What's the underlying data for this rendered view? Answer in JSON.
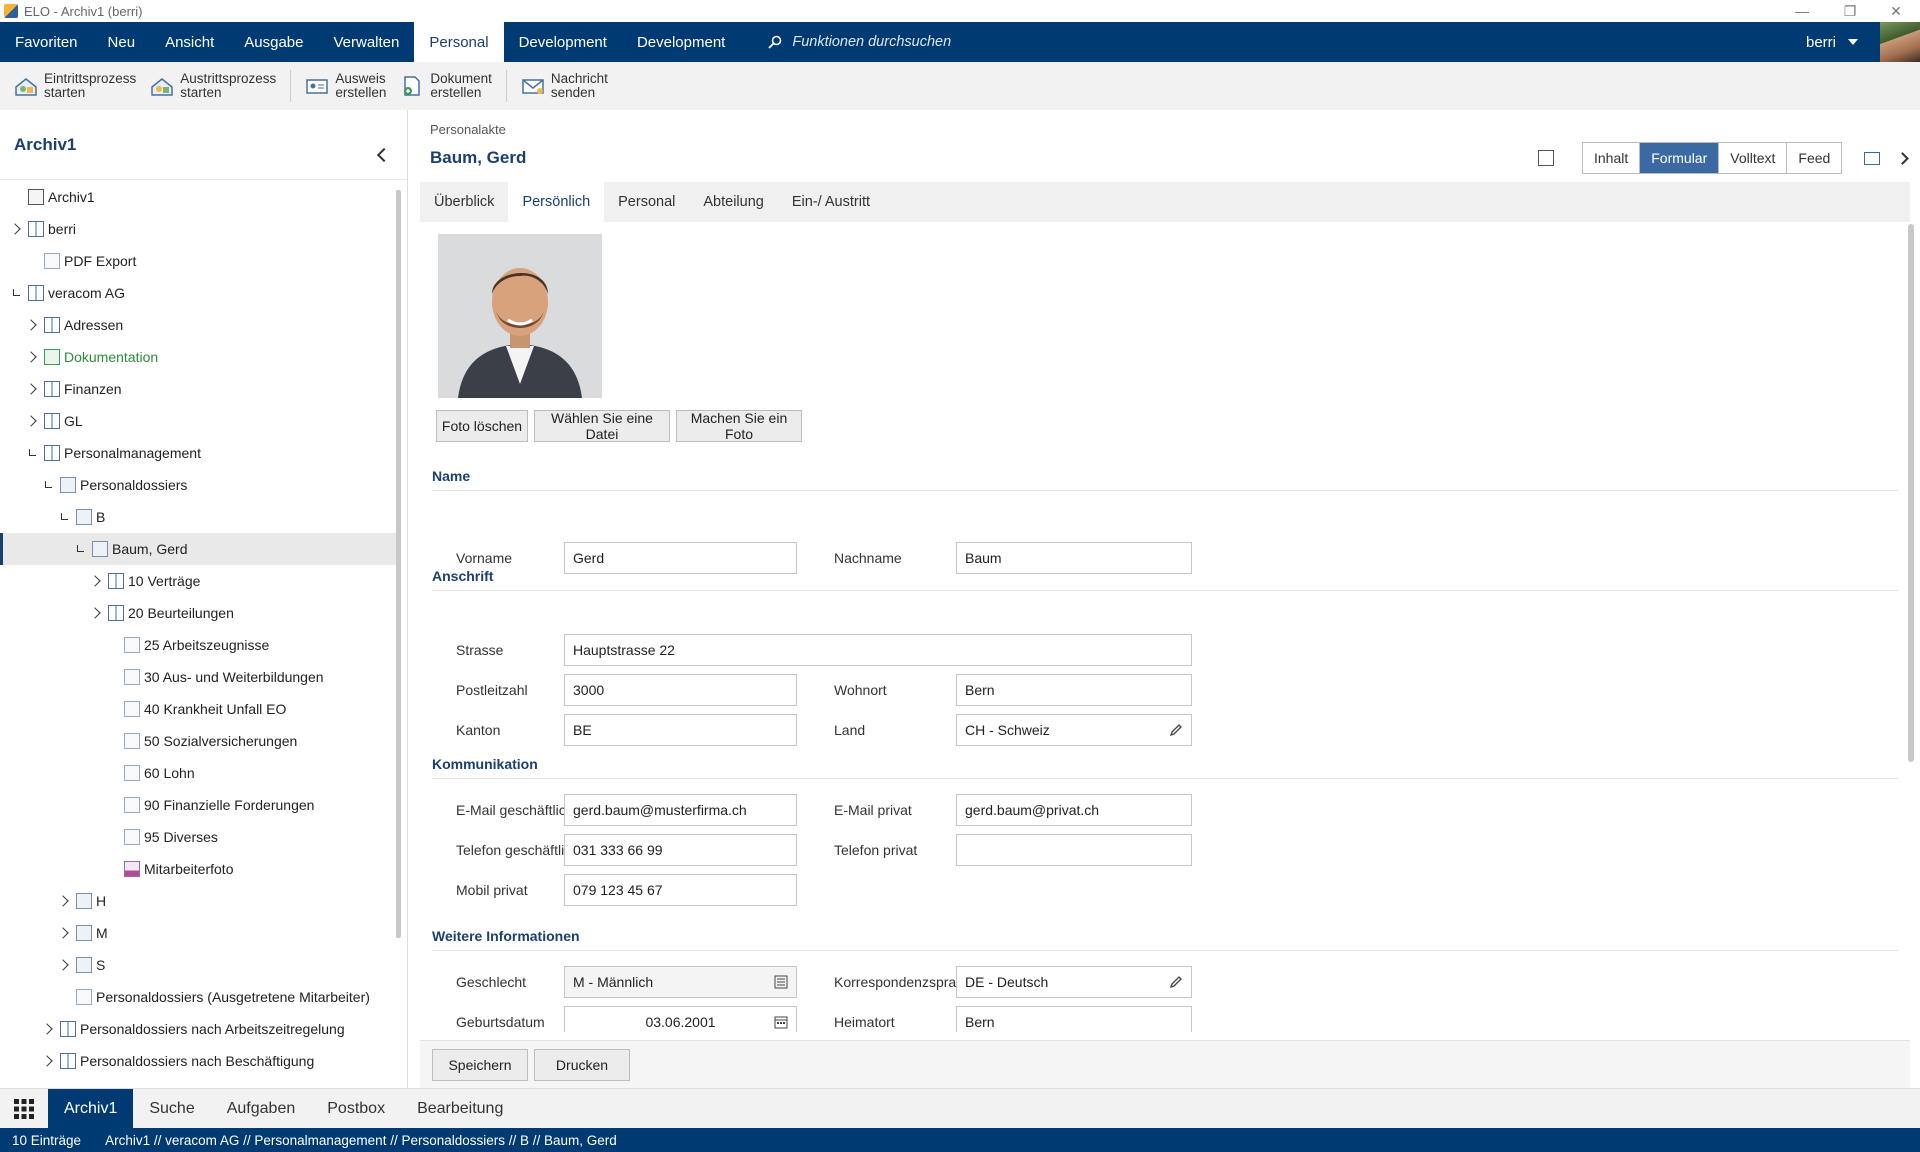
{
  "window": {
    "title": "ELO - Archiv1 (berri)"
  },
  "menubar": {
    "items": [
      "Favoriten",
      "Neu",
      "Ansicht",
      "Ausgabe",
      "Verwalten",
      "Personal",
      "Development",
      "Development"
    ],
    "active_index": 5,
    "search_placeholder": "Funktionen durchsuchen",
    "user": "berri"
  },
  "ribbon": {
    "buttons": [
      {
        "line1": "Eintrittsprozess",
        "line2": "starten",
        "icon": "process-start-icon"
      },
      {
        "line1": "Austrittsprozess",
        "line2": "starten",
        "icon": "process-exit-icon"
      },
      {
        "line1": "Ausweis",
        "line2": "erstellen",
        "icon": "id-card-icon"
      },
      {
        "line1": "Dokument",
        "line2": "erstellen",
        "icon": "document-add-icon"
      },
      {
        "line1": "Nachricht",
        "line2": "senden",
        "icon": "mail-icon"
      }
    ]
  },
  "leftpanel": {
    "title": "Archiv1",
    "tree": [
      {
        "label": "Archiv1",
        "level": 0,
        "exp": "none",
        "icon": "arch"
      },
      {
        "label": "berri",
        "level": 0,
        "exp": "closed",
        "icon": "cab"
      },
      {
        "label": "PDF Export",
        "level": 1,
        "exp": "none",
        "icon": "doc"
      },
      {
        "label": "veracom AG",
        "level": 0,
        "exp": "open",
        "icon": "cab"
      },
      {
        "label": "Adressen",
        "level": 1,
        "exp": "closed",
        "icon": "cab"
      },
      {
        "label": "Dokumentation",
        "level": 1,
        "exp": "closed",
        "icon": "fold-g",
        "green": true
      },
      {
        "label": "Finanzen",
        "level": 1,
        "exp": "closed",
        "icon": "cab"
      },
      {
        "label": "GL",
        "level": 1,
        "exp": "closed",
        "icon": "cab"
      },
      {
        "label": "Personalmanagement",
        "level": 1,
        "exp": "open",
        "icon": "cab"
      },
      {
        "label": "Personaldossiers",
        "level": 2,
        "exp": "open",
        "icon": "fold"
      },
      {
        "label": "B",
        "level": 3,
        "exp": "open",
        "icon": "fold"
      },
      {
        "label": "Baum, Gerd",
        "level": 4,
        "exp": "open",
        "icon": "fold",
        "selected": true
      },
      {
        "label": "10 Verträge",
        "level": 5,
        "exp": "closed",
        "icon": "cab"
      },
      {
        "label": "20 Beurteilungen",
        "level": 5,
        "exp": "closed",
        "icon": "cab"
      },
      {
        "label": "25 Arbeitszeugnisse",
        "level": 6,
        "exp": "none",
        "icon": "doc"
      },
      {
        "label": "30 Aus- und Weiterbildungen",
        "level": 6,
        "exp": "none",
        "icon": "doc"
      },
      {
        "label": "40 Krankheit Unfall EO",
        "level": 6,
        "exp": "none",
        "icon": "doc"
      },
      {
        "label": "50 Sozialversicherungen",
        "level": 6,
        "exp": "none",
        "icon": "doc"
      },
      {
        "label": "60 Lohn",
        "level": 6,
        "exp": "none",
        "icon": "doc"
      },
      {
        "label": "90 Finanzielle Forderungen",
        "level": 6,
        "exp": "none",
        "icon": "doc"
      },
      {
        "label": "95 Diverses",
        "level": 6,
        "exp": "none",
        "icon": "doc"
      },
      {
        "label": "Mitarbeiterfoto",
        "level": 6,
        "exp": "none",
        "icon": "img"
      },
      {
        "label": "H",
        "level": 3,
        "exp": "closed",
        "icon": "fold"
      },
      {
        "label": "M",
        "level": 3,
        "exp": "closed",
        "icon": "fold"
      },
      {
        "label": "S",
        "level": 3,
        "exp": "closed",
        "icon": "fold"
      },
      {
        "label": "Personaldossiers (Ausgetretene Mitarbeiter)",
        "level": 3,
        "exp": "none",
        "icon": "doc"
      },
      {
        "label": "Personaldossiers nach Arbeitszeitregelung",
        "level": 2,
        "exp": "closed",
        "icon": "cab"
      },
      {
        "label": "Personaldossiers nach Beschäftigung",
        "level": 2,
        "exp": "closed",
        "icon": "cab"
      }
    ]
  },
  "main": {
    "category": "Personalakte",
    "title": "Baum, Gerd",
    "view_tabs": [
      "Inhalt",
      "Formular",
      "Volltext",
      "Feed"
    ],
    "view_active": 1,
    "form_tabs": [
      "Überblick",
      "Persönlich",
      "Personal",
      "Abteilung",
      "Ein-/ Austritt"
    ],
    "form_active": 1
  },
  "form": {
    "photo_buttons": [
      "Foto löschen",
      "Wählen Sie eine Datei",
      "Machen Sie ein Foto"
    ],
    "sections": {
      "name": "Name",
      "address": "Anschrift",
      "communication": "Kommunikation",
      "more": "Weitere Informationen"
    },
    "fields": {
      "vorname": {
        "label": "Vorname",
        "value": "Gerd"
      },
      "nachname": {
        "label": "Nachname",
        "value": "Baum"
      },
      "strasse": {
        "label": "Strasse",
        "value": "Hauptstrasse 22"
      },
      "plz": {
        "label": "Postleitzahl",
        "value": "3000"
      },
      "wohnort": {
        "label": "Wohnort",
        "value": "Bern"
      },
      "kanton": {
        "label": "Kanton",
        "value": "BE"
      },
      "land": {
        "label": "Land",
        "value": "CH - Schweiz"
      },
      "email_g": {
        "label": "E-Mail geschäftlich",
        "value": "gerd.baum@musterfirma.ch"
      },
      "email_p": {
        "label": "E-Mail privat",
        "value": "gerd.baum@privat.ch"
      },
      "tel_g": {
        "label": "Telefon geschäftlich",
        "value": "031 333 66 99"
      },
      "tel_p": {
        "label": "Telefon privat",
        "value": ""
      },
      "mobil": {
        "label": "Mobil privat",
        "value": "079 123 45 67"
      },
      "geschlecht": {
        "label": "Geschlecht",
        "value": "M - Männlich"
      },
      "korr": {
        "label": "Korrespondenzsprache",
        "value": "DE - Deutsch"
      },
      "geburt": {
        "label": "Geburtsdatum",
        "value": "03.06.2001"
      },
      "heimat": {
        "label": "Heimatort",
        "value": "Bern"
      }
    },
    "footer_buttons": [
      "Speichern",
      "Drucken"
    ]
  },
  "bottomnav": {
    "tabs": [
      "Archiv1",
      "Suche",
      "Aufgaben",
      "Postbox",
      "Bearbeitung"
    ],
    "active": 0
  },
  "status": {
    "count": "10 Einträge",
    "path": "Archiv1 // veracom AG // Personalmanagement // Personaldossiers // B // Baum, Gerd"
  },
  "colors": {
    "brand": "#003a73",
    "accent": "#3b6aa3",
    "heading": "#1b3f6e"
  }
}
